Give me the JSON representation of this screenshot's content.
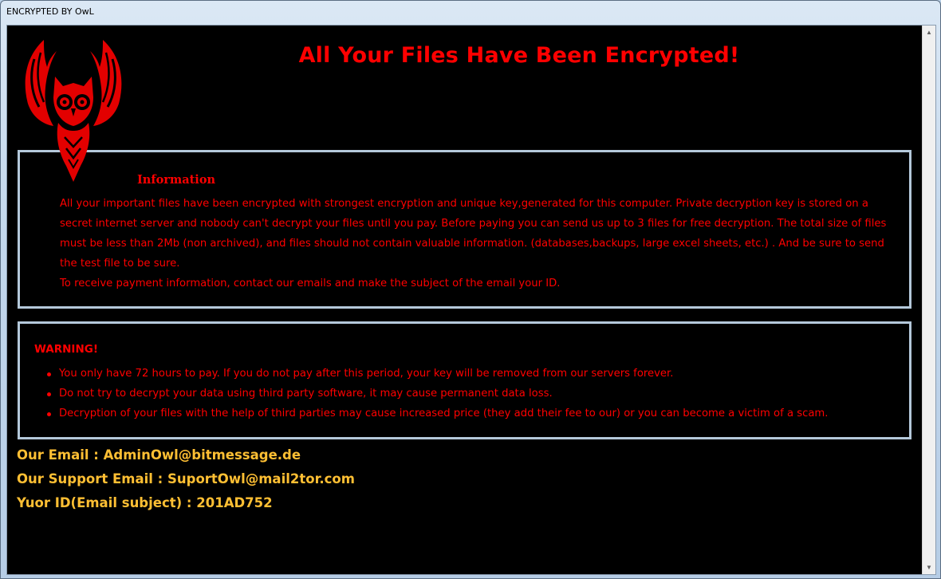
{
  "window": {
    "title": "ENCRYPTED BY OwL"
  },
  "note": {
    "heading": "All Your Files Have Been Encrypted!",
    "information": {
      "title": "Information",
      "paragraph1": "All your important files have been encrypted with strongest encryption and unique key,generated for this computer. Private decryption key is stored on a secret internet server and nobody can't decrypt your files until you pay. Before paying you can send us up to 3 files for free decryption. The total size of files must be less than 2Mb (non archived), and files should not contain valuable information. (databases,backups, large excel sheets, etc.) . And be sure to send the test file to be sure.",
      "paragraph2": "To receive payment information, contact our emails and make the subject of the email your ID."
    },
    "warning": {
      "title": "WARNING!",
      "items": [
        "You only have 72 hours to pay. If you do not pay after this period, your key will be removed from our servers forever.",
        "Do not try to decrypt your data using third party software, it may cause permanent data loss.",
        "Decryption of your files with the help of third parties may cause increased price (they add their fee to our) or you can become a victim of a scam."
      ]
    },
    "contacts": {
      "email": "Our Email : AdminOwl@bitmessage.de",
      "support_email": "Our Support Email : SuportOwl@mail2tor.com",
      "id": "Yuor ID(Email subject) : 201AD752"
    }
  },
  "icons": {
    "logo": "owl-emblem-icon",
    "scroll_up": "scroll-up-arrow-icon",
    "scroll_down": "scroll-down-arrow-icon"
  },
  "colors": {
    "background": "#000000",
    "text_red": "#ff0000",
    "contact_orange": "#ffbf33",
    "box_border": "#b4c8da"
  }
}
